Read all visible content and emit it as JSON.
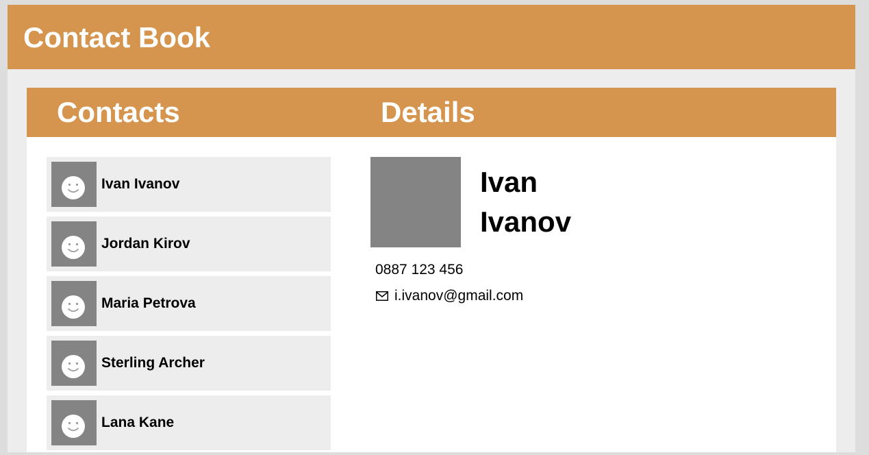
{
  "app": {
    "title": "Contact Book"
  },
  "panel": {
    "contacts_heading": "Contacts",
    "details_heading": "Details"
  },
  "contacts": [
    {
      "name": "Ivan Ivanov"
    },
    {
      "name": "Jordan Kirov"
    },
    {
      "name": "Maria Petrova"
    },
    {
      "name": "Sterling Archer"
    },
    {
      "name": "Lana Kane"
    }
  ],
  "details": {
    "first_name": "Ivan",
    "last_name": "Ivanov",
    "phone": "0887 123 456",
    "email": "i.ivanov@gmail.com",
    "email_icon": "envelope-icon"
  },
  "icons": {
    "avatar": "smiley-face-icon"
  },
  "colors": {
    "accent": "#d5954f",
    "avatar_bg": "#848484",
    "card_bg": "#ededed"
  }
}
